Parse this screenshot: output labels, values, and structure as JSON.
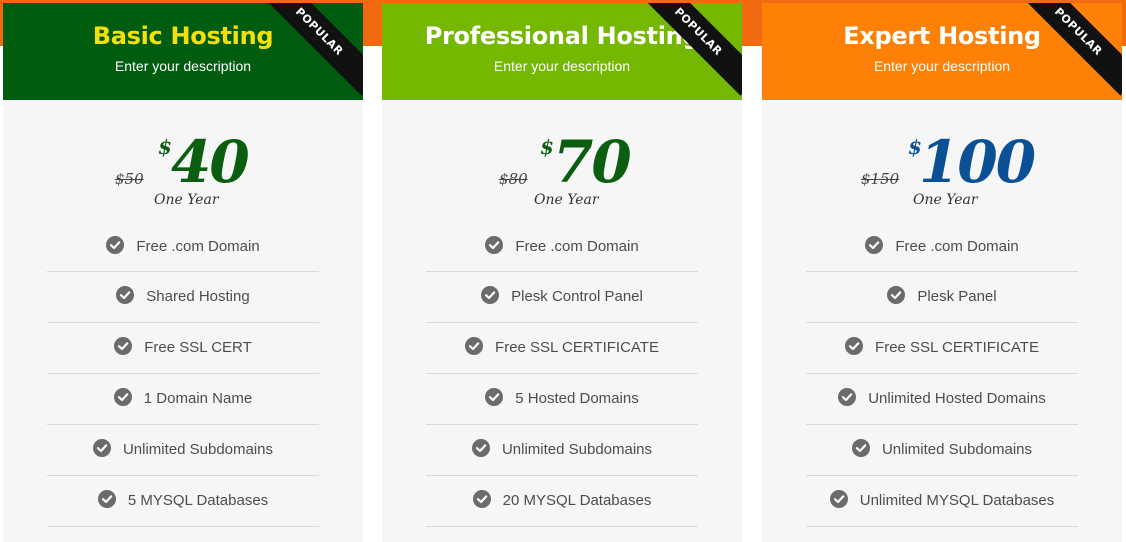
{
  "plans": [
    {
      "title": "Basic Hosting",
      "description": "Enter your description",
      "ribbon": "POPULAR",
      "old_price": "$50",
      "currency": "$",
      "amount": "40",
      "period": "One Year",
      "header_color": "#005d10",
      "title_color": "#f4e10b",
      "price_color": "#0b5d10",
      "features": [
        {
          "label": "Free .com Domain",
          "icon": "check-circle-icon"
        },
        {
          "label": "Shared Hosting",
          "icon": "check-circle-icon"
        },
        {
          "label": "Free SSL CERT",
          "icon": "check-circle-icon"
        },
        {
          "label": "1 Domain Name",
          "icon": "check-circle-icon"
        },
        {
          "label": "Unlimited Subdomains",
          "icon": "check-circle-icon"
        },
        {
          "label": "5 MYSQL Databases",
          "icon": "check-circle-icon"
        }
      ]
    },
    {
      "title": "Professional Hosting",
      "description": "Enter your description",
      "ribbon": "POPULAR",
      "old_price": "$80",
      "currency": "$",
      "amount": "70",
      "period": "One Year",
      "header_color": "#74b801",
      "title_color": "#ffffff",
      "price_color": "#0b5d10",
      "features": [
        {
          "label": "Free .com Domain",
          "icon": "check-circle-icon"
        },
        {
          "label": "Plesk Control Panel",
          "icon": "check-circle-icon"
        },
        {
          "label": "Free SSL CERTIFICATE",
          "icon": "check-circle-icon"
        },
        {
          "label": "5 Hosted Domains",
          "icon": "check-circle-icon"
        },
        {
          "label": "Unlimited Subdomains",
          "icon": "check-circle-icon"
        },
        {
          "label": "20 MYSQL Databases",
          "icon": "check-circle-icon"
        }
      ]
    },
    {
      "title": "Expert Hosting",
      "description": "Enter your description",
      "ribbon": "POPULAR",
      "old_price": "$150",
      "currency": "$",
      "amount": "100",
      "period": "One Year",
      "header_color": "#ff8006",
      "title_color": "#ffffff",
      "price_color": "#0b4f95",
      "features": [
        {
          "label": "Free .com Domain",
          "icon": "check-circle-icon"
        },
        {
          "label": "Plesk Panel",
          "icon": "check-circle-icon"
        },
        {
          "label": "Free SSL CERTIFICATE",
          "icon": "check-circle-icon"
        },
        {
          "label": "Unlimited Hosted Domains",
          "icon": "check-circle-icon"
        },
        {
          "label": "Unlimited Subdomains",
          "icon": "check-circle-icon"
        },
        {
          "label": "Unlimited MYSQL Databases",
          "icon": "check-circle-icon"
        }
      ]
    }
  ]
}
